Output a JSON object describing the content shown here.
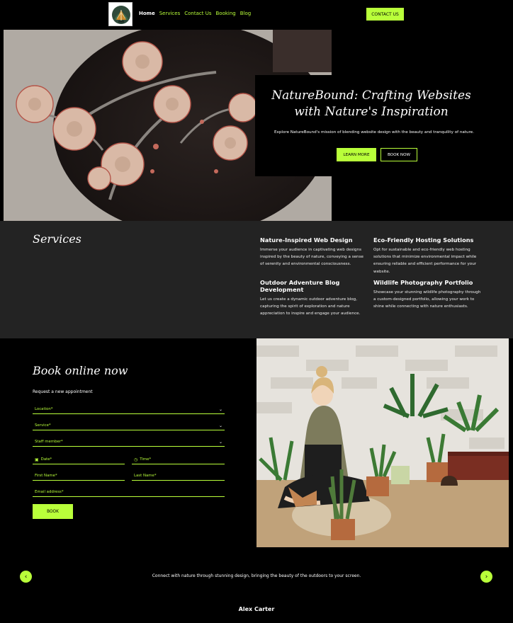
{
  "nav": {
    "links": [
      "Home",
      "Services",
      "Contact Us",
      "Booking",
      "Blog"
    ],
    "contact_label": "CONTACT US"
  },
  "hero": {
    "title": "NatureBound: Crafting Websites with Nature's Inspiration",
    "subtitle": "Explore NatureBound's mission of blending website design with the beauty and tranquility of nature.",
    "learn_label": "LEARN MORE",
    "book_label": "BOOK NOW"
  },
  "services": {
    "title": "Services",
    "items": [
      {
        "title": "Nature-Inspired Web Design",
        "desc": "Immerse your audience in captivating web designs inspired by the beauty of nature, conveying a sense of serenity and environmental consciousness."
      },
      {
        "title": "Eco-Friendly Hosting Solutions",
        "desc": "Opt for sustainable and eco-friendly web hosting solutions that minimize environmental impact while ensuring reliable and efficient performance for your website."
      },
      {
        "title": "Outdoor Adventure Blog Development",
        "desc": "Let us create a dynamic outdoor adventure blog, capturing the spirit of exploration and nature appreciation to inspire and engage your audience."
      },
      {
        "title": "Wildlife Photography Portfolio",
        "desc": "Showcase your stunning wildlife photography through a custom-designed portfolio, allowing your work to shine while connecting with nature enthusiasts."
      }
    ]
  },
  "booking": {
    "title": "Book online now",
    "subtitle": "Request a new appointment",
    "location": "Location*",
    "service": "Service*",
    "staff": "Staff member*",
    "date": "Date*",
    "time": "Time*",
    "first_name": "First Name*",
    "last_name": "Last Name*",
    "email": "Email address*",
    "submit": "BOOK"
  },
  "testimonial": {
    "quote": "Connect with nature through stunning design, bringing the beauty of the outdoors to your screen.",
    "author": "Alex Carter"
  },
  "colors": {
    "accent": "#b9ff3a",
    "background": "#000000",
    "section": "#232323"
  }
}
